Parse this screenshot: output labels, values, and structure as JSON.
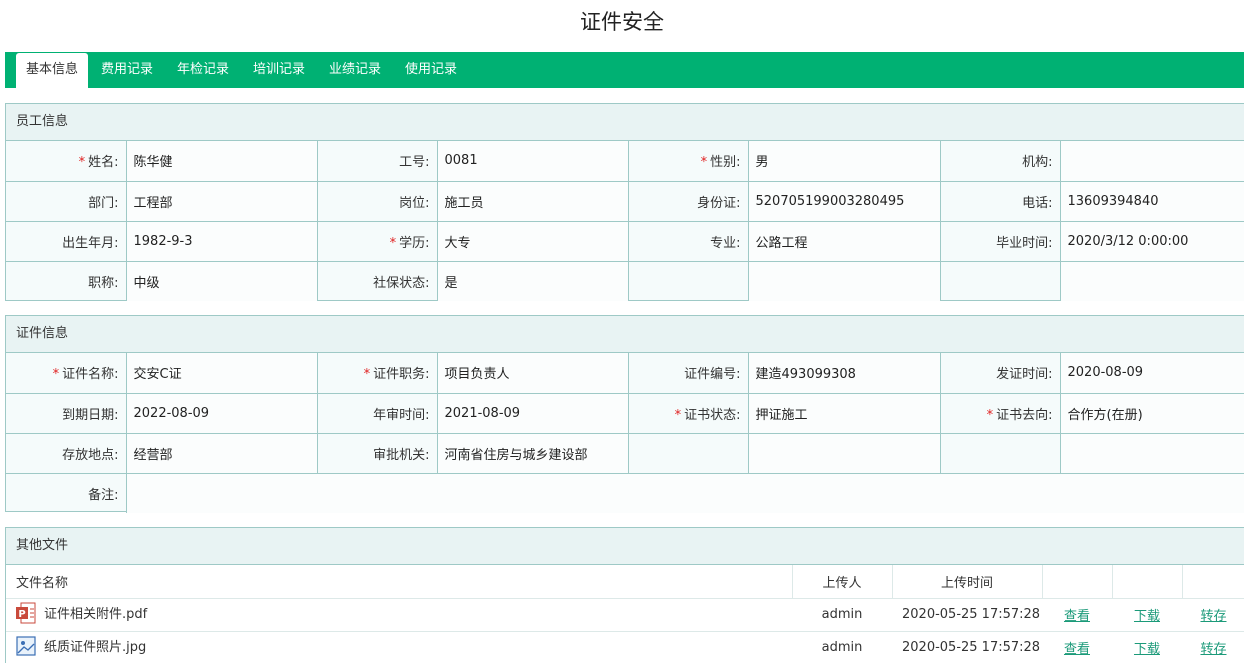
{
  "page": {
    "title": "证件安全"
  },
  "tabs": [
    {
      "label": "基本信息",
      "active": true
    },
    {
      "label": "费用记录"
    },
    {
      "label": "年检记录"
    },
    {
      "label": "培训记录"
    },
    {
      "label": "业绩记录"
    },
    {
      "label": "使用记录"
    }
  ],
  "employee": {
    "header": "员工信息",
    "name_label": "姓名:",
    "name": "陈华健",
    "id_label": "工号:",
    "id": "0081",
    "gender_label": "性别:",
    "gender": "男",
    "org_label": "机构:",
    "org": "",
    "dept_label": "部门:",
    "dept": "工程部",
    "post_label": "岗位:",
    "post": "施工员",
    "idcard_label": "身份证:",
    "idcard": "520705199003280495",
    "phone_label": "电话:",
    "phone": "13609394840",
    "birth_label": "出生年月:",
    "birth": "1982-9-3",
    "edu_label": "学历:",
    "edu": "大专",
    "major_label": "专业:",
    "major": "公路工程",
    "grad_label": "毕业时间:",
    "grad": "2020/3/12 0:00:00",
    "title_label": "职称:",
    "title": "中级",
    "social_label": "社保状态:",
    "social": "是"
  },
  "certificate": {
    "header": "证件信息",
    "cname_label": "证件名称:",
    "cname": "交安C证",
    "cduty_label": "证件职务:",
    "cduty": "项目负责人",
    "cno_label": "证件编号:",
    "cno": "建造493099308",
    "issue_label": "发证时间:",
    "issue": "2020-08-09",
    "expire_label": "到期日期:",
    "expire": "2022-08-09",
    "audit_label": "年审时间:",
    "audit": "2021-08-09",
    "status_label": "证书状态:",
    "status": "押证施工",
    "dest_label": "证书去向:",
    "dest": "合作方(在册)",
    "store_label": "存放地点:",
    "store": "经营部",
    "authority_label": "审批机关:",
    "authority": "河南省住房与城乡建设部",
    "remark_label": "备注:",
    "remark": ""
  },
  "files": {
    "header": "其他文件",
    "col_name": "文件名称",
    "col_uploader": "上传人",
    "col_time": "上传时间",
    "rows": [
      {
        "icon": "pdf-file-icon",
        "name": "证件相关附件.pdf",
        "uploader": "admin",
        "time": "2020-05-25 17:57:28",
        "view": "查看",
        "download": "下载",
        "transfer": "转存"
      },
      {
        "icon": "image-file-icon",
        "name": "纸质证件照片.jpg",
        "uploader": "admin",
        "time": "2020-05-25 17:57:28",
        "view": "查看",
        "download": "下载",
        "transfer": "转存"
      }
    ]
  },
  "colors": {
    "accent": "#00b173",
    "border": "#9ec9c6",
    "link": "#1b9a79",
    "required": "#e02020"
  }
}
